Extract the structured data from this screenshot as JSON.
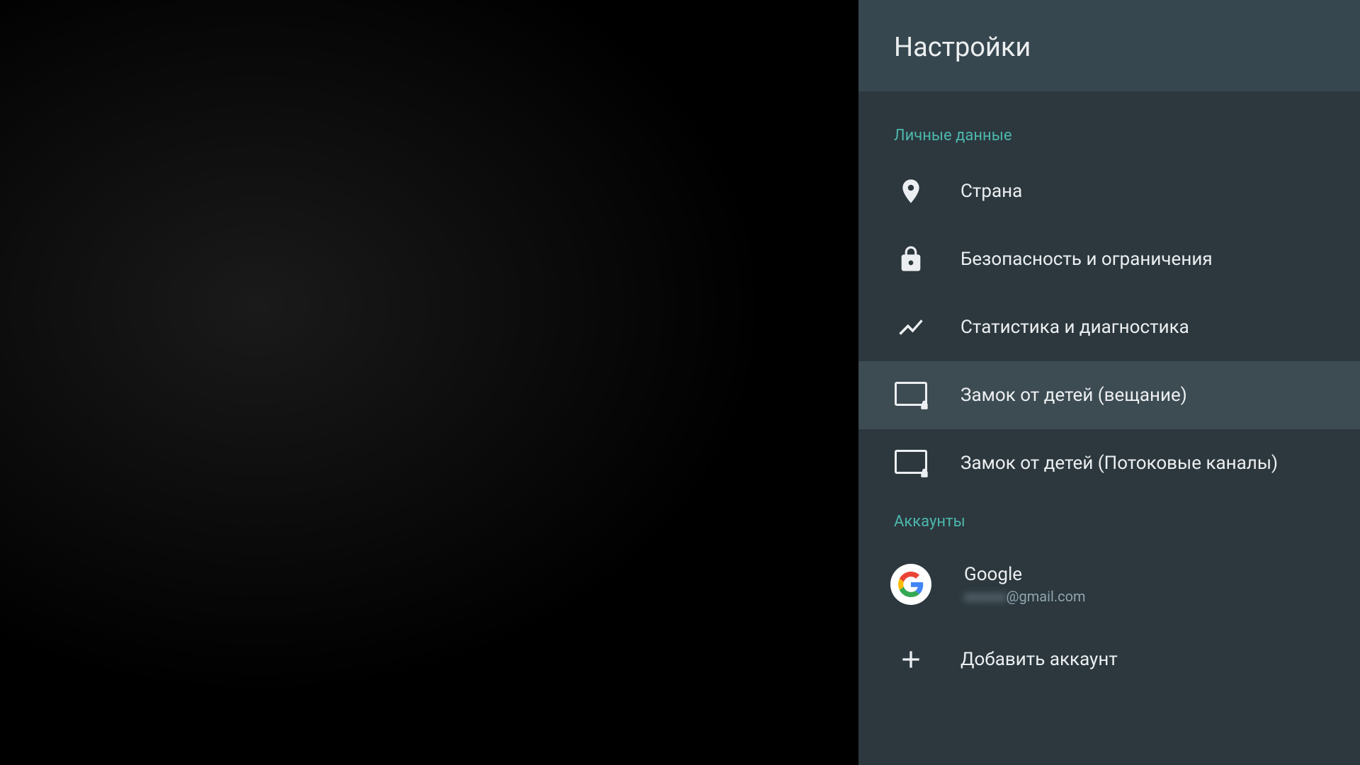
{
  "header": {
    "title": "Настройки"
  },
  "sections": {
    "personal": {
      "title": "Личные данные",
      "items": [
        {
          "label": "Страна"
        },
        {
          "label": "Безопасность и ограничения"
        },
        {
          "label": "Статистика и диагностика"
        },
        {
          "label": "Замок от детей (вещание)"
        },
        {
          "label": "Замок от детей (Потоковые каналы)"
        }
      ]
    },
    "accounts": {
      "title": "Аккаунты",
      "items": [
        {
          "title": "Google",
          "email_hidden": "хххххх",
          "email_domain": "@gmail.com"
        },
        {
          "label": "Добавить аккаунт"
        }
      ]
    }
  }
}
